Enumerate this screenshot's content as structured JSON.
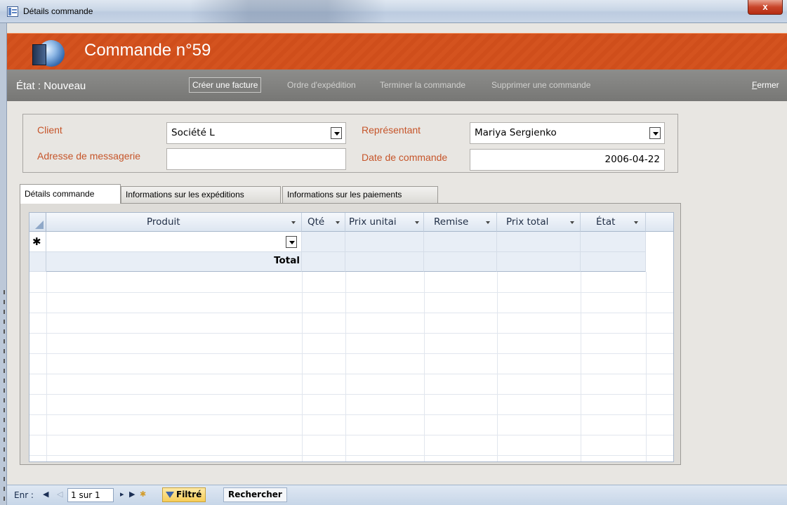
{
  "window": {
    "title": "Détails commande",
    "close_symbol": "x"
  },
  "header": {
    "title": "Commande n°59"
  },
  "actionbar": {
    "state_label": "État :",
    "state_value": "Nouveau",
    "actions": {
      "create_invoice": "Créer une facture",
      "shipping_order": "Ordre d'expédition",
      "complete_order": "Terminer la commande",
      "delete_order": "Supprimer une commande",
      "close_first": "F",
      "close_rest": "ermer"
    }
  },
  "form": {
    "client_label": "Client",
    "client_value": "Société L",
    "address_label": "Adresse de messagerie",
    "address_value": "",
    "rep_label": "Représentant",
    "rep_value": "Mariya Sergienko",
    "date_label": "Date de commande",
    "date_value": "2006-04-22"
  },
  "tabs": [
    {
      "label": "Détails commande",
      "active": true
    },
    {
      "label": "Informations sur les expéditions",
      "active": false
    },
    {
      "label": "Informations sur les paiements",
      "active": false
    }
  ],
  "grid": {
    "columns": [
      "Produit",
      "Qté",
      "Prix unitai",
      "Remise",
      "Prix total",
      "État"
    ],
    "new_row_marker": "✱",
    "total_label": "Total"
  },
  "statusbar": {
    "record_label": "Enr :",
    "record_value": "1 sur 1",
    "filter_label": "Filtré",
    "search_label": "Rechercher"
  }
}
